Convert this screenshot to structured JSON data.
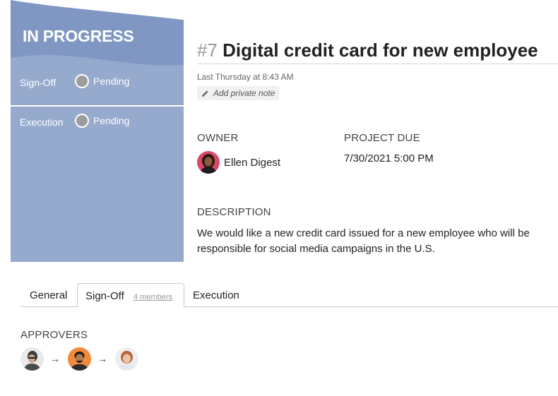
{
  "status_panel": {
    "title": "IN PROGRESS",
    "stages": [
      {
        "name": "Sign-Off",
        "status": "Pending"
      },
      {
        "name": "Execution",
        "status": "Pending"
      }
    ],
    "colors": {
      "panel": "#95aacd",
      "banner": "#7f97c2",
      "pending_dot": "#9d9d9d"
    }
  },
  "ticket": {
    "number": "#7",
    "title": "Digital credit card for new employee",
    "timestamp": "Last Thursday at 8:43 AM",
    "note_button": "Add private note"
  },
  "fields": {
    "owner_label": "OWNER",
    "owner_name": "Ellen Digest",
    "due_label": "PROJECT DUE",
    "due_value": "7/30/2021 5:00 PM",
    "description_label": "DESCRIPTION",
    "description": "We would like a new credit card issued for a new employee who will be responsible for social media campaigns in the U.S."
  },
  "tabs": {
    "general": "General",
    "signoff": "Sign-Off",
    "signoff_members": "4 members",
    "execution": "Execution",
    "active": "signoff"
  },
  "approvers": {
    "label": "APPROVERS",
    "arrow": "→"
  }
}
